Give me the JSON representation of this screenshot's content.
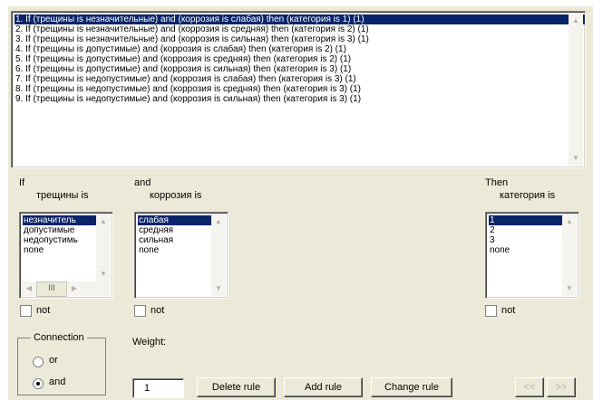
{
  "rules": [
    "1. If (трещины is незначительные) and (коррозия is слабая) then (категория is 1) (1)",
    "2. If (трещины is незначительные) and (коррозия is средняя) then (категория is 2) (1)",
    "3. If (трещины is незначительные) and (коррозия is сильная) then (категория is 3) (1)",
    "4. If (трещины is допустимые) and (коррозия is слабая) then (категория is 2) (1)",
    "5. If (трещины is допустимые) and (коррозия is средняя) then (категория is 2) (1)",
    "6. If (трещины is допустимые) and (коррозия is сильная) then (категория is 3) (1)",
    "7. If (трещины is недопустимые) and (коррозия is слабая) then (категория is 3) (1)",
    "8. If (трещины is недопустимые) and (коррозия is средняя) then (категория is 3) (1)",
    "9. If (трещины is недопустимые) and (коррозия is сильная) then (категория is 3) (1)"
  ],
  "if_section": {
    "label": "If",
    "var_label": "трещины is",
    "options": [
      "незначитель",
      "допустимые",
      "недопустимь",
      "none"
    ],
    "not_label": "not"
  },
  "and_section": {
    "label": "and",
    "var_label": "коррозия is",
    "options": [
      "слабая",
      "средняя",
      "сильная",
      "none"
    ],
    "not_label": "not"
  },
  "then_section": {
    "label": "Then",
    "var_label": "категория is",
    "options": [
      "1",
      "2",
      "3",
      "none"
    ],
    "not_label": "not"
  },
  "hscroll_thumb": "III",
  "connection": {
    "title": "Connection",
    "or_label": "or",
    "and_label": "and",
    "selected": "and"
  },
  "weight": {
    "label": "Weight:",
    "value": "1"
  },
  "buttons": {
    "delete": "Delete rule",
    "add": "Add rule",
    "change": "Change rule",
    "prev": "<<",
    "next": ">>"
  }
}
